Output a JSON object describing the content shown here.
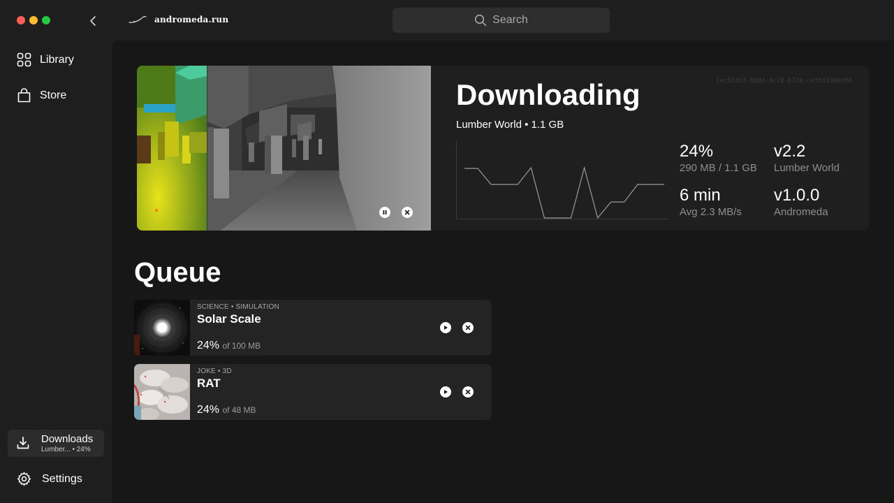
{
  "window": {
    "traffic_lights": [
      "close",
      "minimize",
      "maximize"
    ]
  },
  "brand": {
    "name": "andromeda.run"
  },
  "search": {
    "placeholder": "Search"
  },
  "sidebar": {
    "items": [
      {
        "label": "Library",
        "icon": "grid-icon"
      },
      {
        "label": "Store",
        "icon": "bag-icon"
      }
    ],
    "downloads": {
      "label": "Downloads",
      "status": "Lumber... • 24%",
      "icon": "download-icon"
    },
    "settings": {
      "label": "Settings",
      "icon": "gear-icon"
    }
  },
  "current": {
    "uuid": "1ec93363-8ddd-4c28-b72e-c4fb3330d398",
    "title": "Downloading",
    "subtitle": "Lumber World • 1.1 GB",
    "progress_percent": "24%",
    "progress_detail": "290 MB / 1.1 GB",
    "time_left": "6 min",
    "avg_speed": "Avg 2.3 MB/s",
    "game_version": "v2.2",
    "game_name": "Lumber World",
    "engine_version": "v1.0.0",
    "engine_name": "Andromeda",
    "speed_history": [
      0.62,
      0.62,
      0.42,
      0.42,
      0.42,
      0.63,
      0,
      0,
      0,
      0.63,
      0,
      0.2,
      0.2,
      0.42,
      0.42,
      0.42
    ]
  },
  "queue": {
    "title": "Queue",
    "items": [
      {
        "category": "SCIENCE • SIMULATION",
        "name": "Solar Scale",
        "percent": "24%",
        "size": "of 100 MB"
      },
      {
        "category": "JOKE • 3D",
        "name": "RAT",
        "percent": "24%",
        "size": "of 48 MB"
      }
    ]
  },
  "colors": {
    "background": "#1e1e1e",
    "panel": "#171717",
    "card": "#1f1f1f",
    "queue_card": "#242424",
    "muted_text": "#8e8e8e"
  }
}
